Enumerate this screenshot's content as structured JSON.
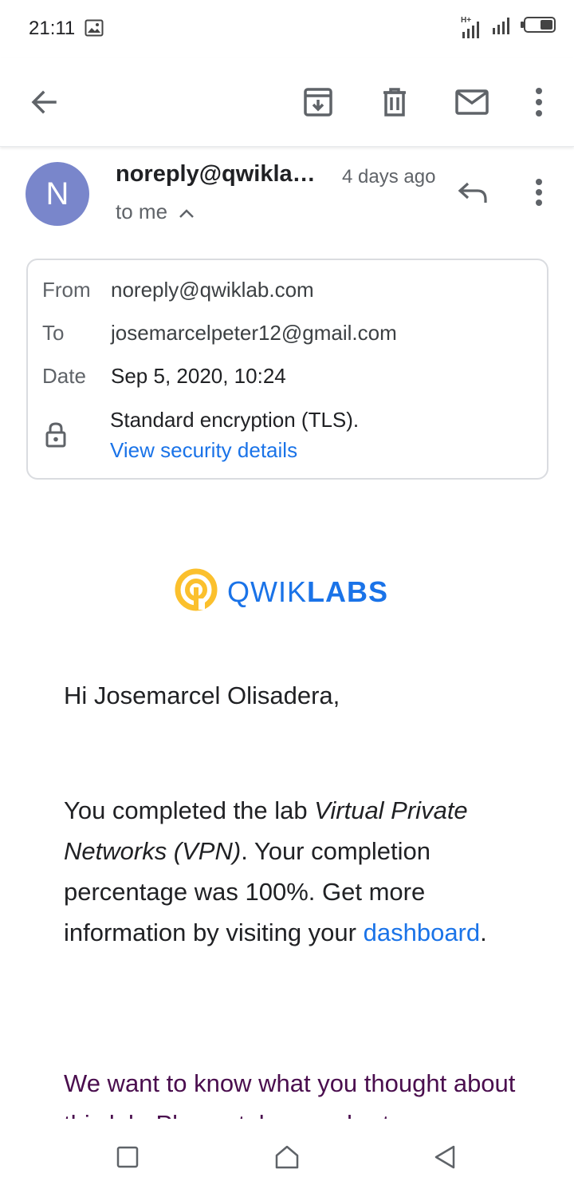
{
  "status_bar": {
    "time": "21:11",
    "network_label": "H+",
    "icons": [
      "image-icon",
      "signal-icon",
      "signal-icon",
      "battery-icon"
    ]
  },
  "toolbar": {
    "icons": [
      "back-arrow-icon",
      "archive-icon",
      "delete-icon",
      "mail-icon",
      "more-vert-icon"
    ]
  },
  "message": {
    "avatar_letter": "N",
    "sender": "noreply@qwikla…",
    "date_ago": "4 days ago",
    "recipient_summary": "to me",
    "details": {
      "from_label": "From",
      "from_value": "noreply@qwiklab.com",
      "to_label": "To",
      "to_value": "josemarcelpeter12@gmail.com",
      "date_label": "Date",
      "date_value": "Sep 5, 2020, 10:24",
      "encryption": "Standard encryption (TLS).",
      "security_link": "View security details"
    }
  },
  "email_body": {
    "logo_light": "QWIK",
    "logo_bold": "LABS",
    "greeting": "Hi Josemarcel Olisadera,",
    "para_prefix": "You completed the lab ",
    "lab_name": "Virtual Private Networks (VPN)",
    "para_middle": ". Your completion percentage was 100%. Get more information by visiting your ",
    "dashboard_link": "dashboard",
    "para_suffix": ".",
    "survey_text": "We want to know what you thought about this lab. Please take our short"
  },
  "colors": {
    "accent": "#1a73e8",
    "avatar": "#7986cb",
    "logo_yellow": "#fbc02d",
    "survey_text": "#4a0e4e"
  }
}
